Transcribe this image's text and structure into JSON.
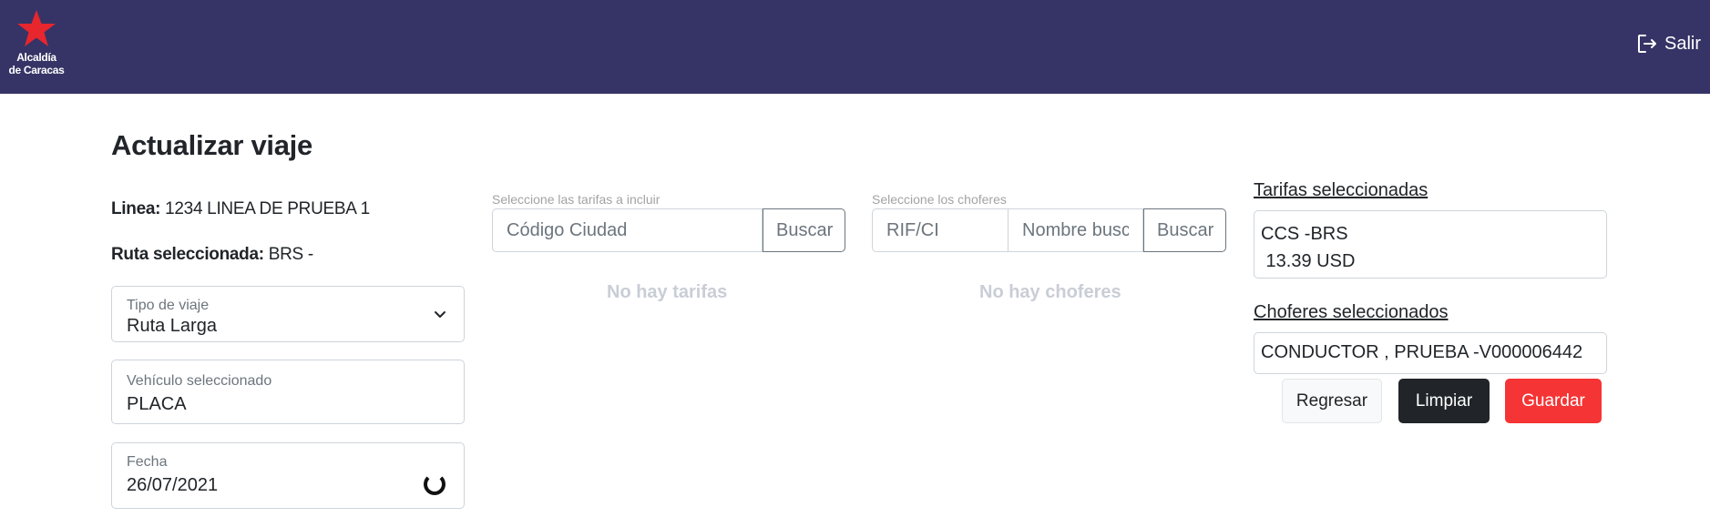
{
  "header": {
    "logo_line1": "Alcaldía",
    "logo_line2": "de Caracas",
    "logout_label": "Salir",
    "logout_icon": "logout-icon",
    "logo_icon": "star-icon"
  },
  "page": {
    "title": "Actualizar viaje"
  },
  "info": {
    "linea_label": "Linea:",
    "linea_value": "1234 LINEA DE PRUEBA 1",
    "ruta_label": "Ruta seleccionada:",
    "ruta_value": "BRS -"
  },
  "form": {
    "tipo_label": "Tipo de viaje",
    "tipo_value": "Ruta Larga",
    "vehiculo_label": "Vehículo seleccionado",
    "vehiculo_value": "PLACA",
    "fecha_label": "Fecha",
    "fecha_value": "26/07/2021"
  },
  "tarifas_search": {
    "label": "Seleccione las tarifas a incluir",
    "placeholder": "Código Ciudad",
    "button": "Buscar",
    "empty": "No hay tarifas"
  },
  "choferes_search": {
    "label": "Seleccione los choferes",
    "placeholder_rif": "RIF/CI",
    "placeholder_nombre": "Nombre busc",
    "button": "Buscar",
    "empty": "No hay choferes"
  },
  "selected": {
    "tarifas_title": "Tarifas seleccionadas",
    "tarifa_line1": "CCS -BRS",
    "tarifa_line2": " 13.39 USD",
    "choferes_title": "Choferes seleccionados",
    "chofer_line": "CONDUCTOR , PRUEBA -V000006442"
  },
  "actions": {
    "back": "Regresar",
    "clear": "Limpiar",
    "save": "Guardar"
  },
  "colors": {
    "header_bg": "#363466",
    "logo_star": "#e8262d",
    "save_btn": "#f53435",
    "clear_btn": "#212529"
  }
}
